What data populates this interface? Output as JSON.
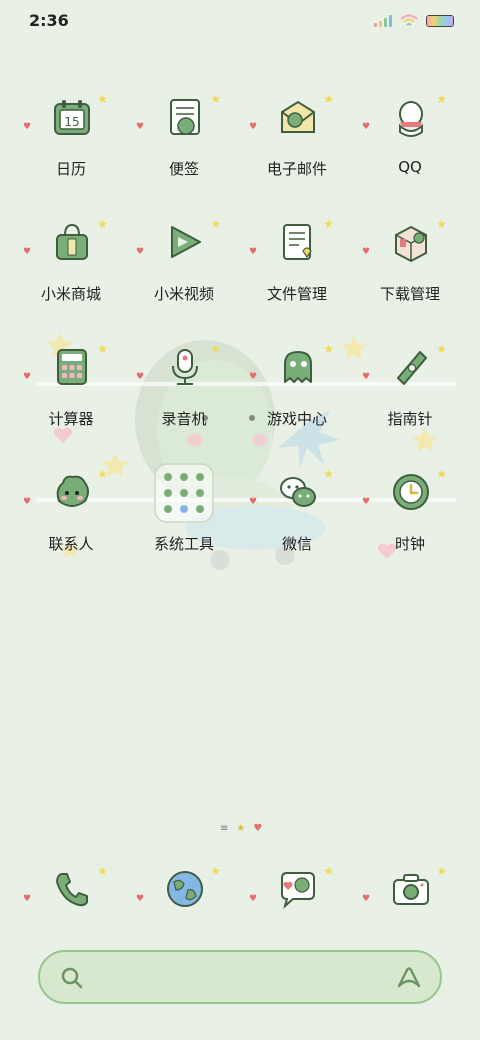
{
  "status": {
    "time": "2:36"
  },
  "apps": [
    {
      "label": "日历",
      "icon": "calendar-icon",
      "badge": "15"
    },
    {
      "label": "便签",
      "icon": "notes-icon"
    },
    {
      "label": "电子邮件",
      "icon": "email-icon"
    },
    {
      "label": "QQ",
      "icon": "qq-icon"
    },
    {
      "label": "小米商城",
      "icon": "mi-store-icon"
    },
    {
      "label": "小米视频",
      "icon": "mi-video-icon"
    },
    {
      "label": "文件管理",
      "icon": "file-manager-icon"
    },
    {
      "label": "下载管理",
      "icon": "downloads-icon"
    },
    {
      "label": "计算器",
      "icon": "calculator-icon"
    },
    {
      "label": "录音机",
      "icon": "recorder-icon"
    },
    {
      "label": "游戏中心",
      "icon": "game-center-icon"
    },
    {
      "label": "指南针",
      "icon": "compass-icon"
    },
    {
      "label": "联系人",
      "icon": "contacts-icon"
    },
    {
      "label": "系统工具",
      "icon": "system-tools-folder-icon"
    },
    {
      "label": "微信",
      "icon": "wechat-icon"
    },
    {
      "label": "时钟",
      "icon": "clock-icon"
    }
  ],
  "dock": [
    {
      "icon": "phone-icon"
    },
    {
      "icon": "browser-globe-icon"
    },
    {
      "icon": "messages-icon"
    },
    {
      "icon": "camera-icon"
    }
  ],
  "colors": {
    "background": "#e9f1e6",
    "accent_green": "#7aae79",
    "star": "#f1d95a",
    "heart": "#e76b6b"
  }
}
